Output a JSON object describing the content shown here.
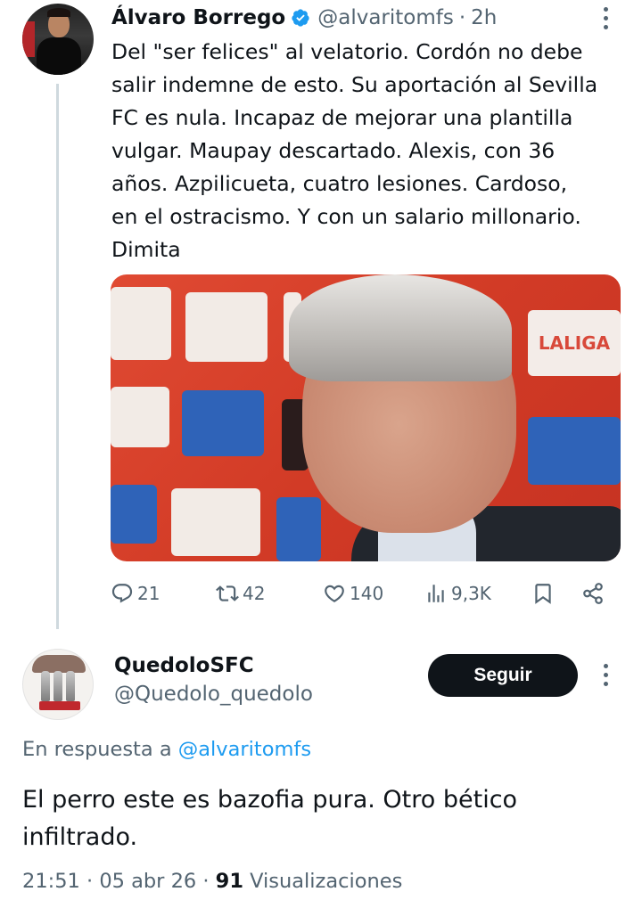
{
  "tweet": {
    "author_name": "Álvaro Borrego",
    "author_handle": "@alvaritomfs",
    "separator": "·",
    "time": "2h",
    "text": "Del \"ser felices\" al velatorio. Cordón no debe\nsalir indemne de esto. Su aportación al Sevilla\nFC es nula. Incapaz de mejorar una plantilla\nvulgar. Maupay descartado. Alexis, con 36\naños. Azpilicueta, cuatro lesiones. Cardoso,\nen el ostracismo. Y con un salario millonario.\nDimita",
    "media_sign": "LALIGA",
    "actions": {
      "replies": "21",
      "retweets": "42",
      "likes": "140",
      "views": "9,3K"
    },
    "icons": {
      "verified": "verified-badge-icon",
      "reply": "reply-icon",
      "retweet": "retweet-icon",
      "like": "heart-icon",
      "views": "views-bar-chart-icon",
      "bookmark": "bookmark-icon",
      "share": "share-icon",
      "more": "more-vertical-icon"
    }
  },
  "reply": {
    "author_name": "QuedoloSFC",
    "author_handle": "@Quedolo_quedolo",
    "follow_label": "Seguir",
    "reply_prefix": "En respuesta a",
    "reply_to": "@alvaritomfs",
    "text": "El perro este es bazofia pura. Otro bético infiltrado.",
    "time": "21:51",
    "date": "05 abr 26",
    "sep": "·",
    "views_count": "91",
    "views_label": "Visualizaciones"
  },
  "colors": {
    "text": "#0f1419",
    "secondary": "#536471",
    "link": "#1d9bf0",
    "verified": "#1d9bf0",
    "button_bg": "#0f1419"
  }
}
